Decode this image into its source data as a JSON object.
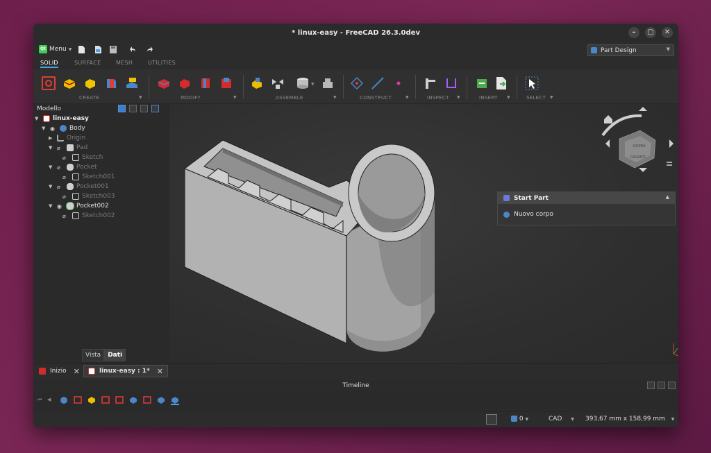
{
  "window": {
    "title": "* linux-easy - FreeCAD 26.3.0dev",
    "controls": [
      "–",
      "▢",
      "✕"
    ]
  },
  "menu": {
    "qt_logo": "Qt",
    "label": "Menu"
  },
  "workbench": {
    "selected": "Part Design"
  },
  "ribbon_tabs": [
    "SOLID",
    "SURFACE",
    "MESH",
    "UTILITIES"
  ],
  "toolbar_groups": [
    "CREATE",
    "MODIFY",
    "ASSEMBLE",
    "CONSTRUCT",
    "INSPECT",
    "INSERT",
    "SELECT"
  ],
  "model_panel": {
    "title": "Modello",
    "tree": [
      {
        "label": "linux-easy",
        "icon": "document-icon"
      },
      {
        "label": "Body",
        "icon": "body-icon"
      },
      {
        "label": "Origin",
        "icon": "origin-icon"
      },
      {
        "label": "Pad",
        "icon": "pad-icon"
      },
      {
        "label": "Sketch",
        "icon": "sketch-icon"
      },
      {
        "label": "Pocket",
        "icon": "pocket-icon"
      },
      {
        "label": "Sketch001",
        "icon": "sketch-icon"
      },
      {
        "label": "Pocket001",
        "icon": "pocket-icon"
      },
      {
        "label": "Sketch003",
        "icon": "sketch-icon"
      },
      {
        "label": "Pocket002",
        "icon": "pocket-icon"
      },
      {
        "label": "Sketch002",
        "icon": "sketch-icon"
      }
    ],
    "tabs": [
      "Vista",
      "Dati"
    ]
  },
  "task_panel": {
    "title": "Start Part",
    "item": "Nuovo corpo"
  },
  "doc_tabs": [
    "Inizio",
    "linux-easy : 1*"
  ],
  "timeline": {
    "title": "Timeline"
  },
  "status": {
    "layer": "0",
    "nav_style": "CAD",
    "dimensions": "393,67 mm x 158,99 mm"
  },
  "colors": {
    "accent": "#4aa3f0",
    "model_gray": "#b9b9b9",
    "background": "#2c2c2c"
  }
}
